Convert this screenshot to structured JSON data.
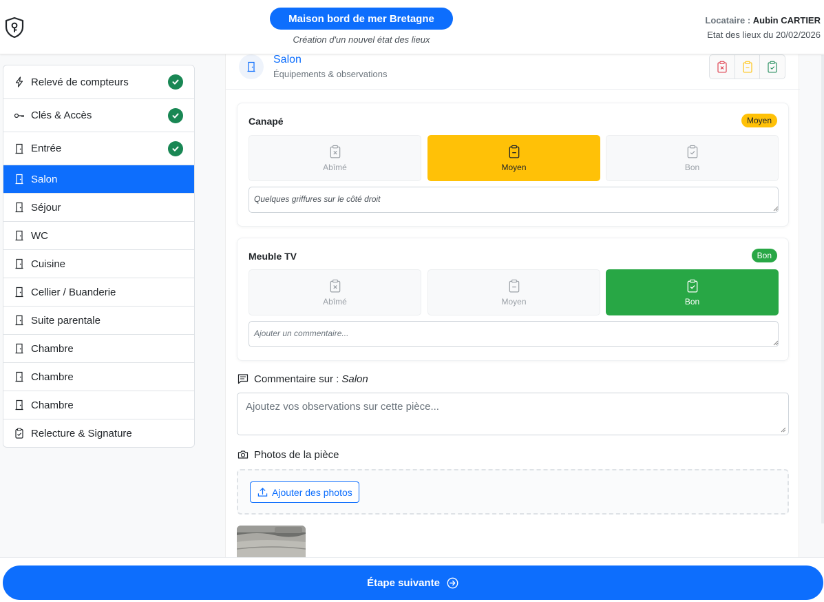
{
  "header": {
    "property_name": "Maison bord de mer Bretagne",
    "subtitle": "Création d'un nouvel état des lieux",
    "tenant_label": "Locataire :",
    "tenant_name": "Aubin CARTIER",
    "edl_date": "Etat des lieux du 20/02/2026"
  },
  "sidebar": {
    "items": [
      {
        "label": "Relevé de compteurs",
        "icon": "lightning-icon",
        "done": true
      },
      {
        "label": "Clés & Accès",
        "icon": "key-icon",
        "done": true
      },
      {
        "label": "Entrée",
        "icon": "door-icon",
        "done": true
      },
      {
        "label": "Salon",
        "icon": "door-icon",
        "active": true
      },
      {
        "label": "Séjour",
        "icon": "door-icon"
      },
      {
        "label": "WC",
        "icon": "door-icon"
      },
      {
        "label": "Cuisine",
        "icon": "door-icon"
      },
      {
        "label": "Cellier / Buanderie",
        "icon": "door-icon"
      },
      {
        "label": "Suite parentale",
        "icon": "door-icon"
      },
      {
        "label": "Chambre",
        "icon": "door-icon"
      },
      {
        "label": "Chambre",
        "icon": "door-icon"
      },
      {
        "label": "Chambre",
        "icon": "door-icon"
      },
      {
        "label": "Relecture & Signature",
        "icon": "clipboard-check-icon"
      }
    ]
  },
  "room": {
    "title": "Salon",
    "subtitle": "Équipements & observations"
  },
  "equipment": [
    {
      "name": "Canapé",
      "badge": "Moyen",
      "options": [
        "Abîmé",
        "Moyen",
        "Bon"
      ],
      "selected": "Moyen",
      "comment": "Quelques griffures sur le côté droit"
    },
    {
      "name": "Meuble TV",
      "badge": "Bon",
      "options": [
        "Abîmé",
        "Moyen",
        "Bon"
      ],
      "selected": "Bon",
      "comment_placeholder": "Ajouter un commentaire..."
    }
  ],
  "room_comment": {
    "label_prefix": "Commentaire sur :",
    "label_room": "Salon",
    "placeholder": "Ajoutez vos observations sur cette pièce..."
  },
  "photos": {
    "label": "Photos de la pièce",
    "add_button": "Ajouter des photos"
  },
  "footer": {
    "next_label": "Étape suivante"
  },
  "colors": {
    "primary": "#0d6efd",
    "warning": "#ffc107",
    "success": "#28a745",
    "danger": "#dc3545"
  }
}
